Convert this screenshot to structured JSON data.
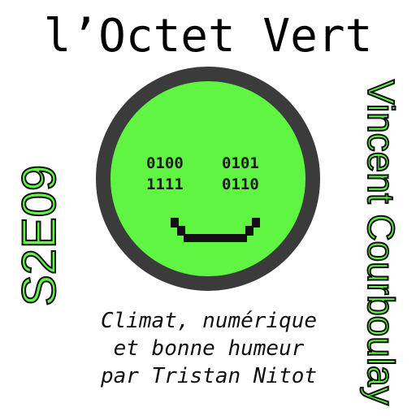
{
  "title": "l’Octet Vert",
  "episode": "S2E09",
  "guest": "Vincent Courboulay",
  "face": {
    "eye_left": [
      "0100",
      "1111"
    ],
    "eye_right": [
      "0101",
      "0110"
    ]
  },
  "tagline": [
    "Climat, numérique",
    "et bonne humeur",
    "par Tristan Nitot"
  ],
  "colors": {
    "accent": "#5ff542",
    "ring": "#3b3b3b",
    "text": "#111111",
    "background": "#ffffff"
  }
}
